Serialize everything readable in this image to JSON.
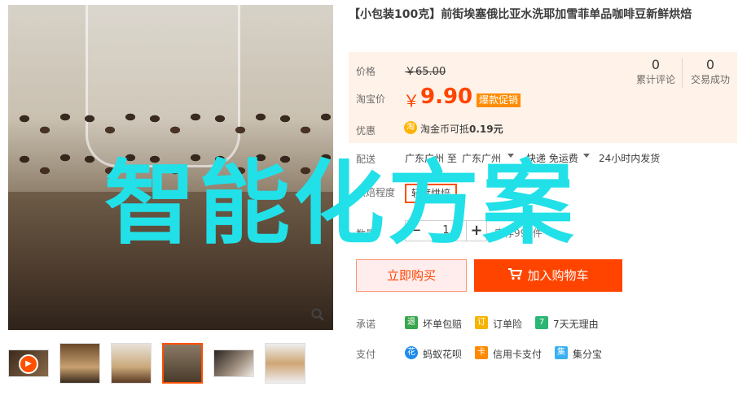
{
  "product": {
    "title": "【小包装100克】前街埃塞俄比亚水洗耶加雪菲单品咖啡豆新鲜烘焙"
  },
  "price": {
    "label": "价格",
    "original": "￥65.00",
    "sale_label": "淘宝价",
    "sale_currency": "￥",
    "sale_value": "9.90",
    "promo_badge": "爆款促销"
  },
  "stats": {
    "reviews_count": "0",
    "reviews_label": "累计评论",
    "sales_count": "0",
    "sales_label": "交易成功"
  },
  "coupon": {
    "label": "优惠",
    "icon": "淘",
    "text_prefix": "淘金币可抵",
    "amount": "0.19元"
  },
  "shipping": {
    "label": "配送",
    "from": "广东广州 至",
    "to": "广东广州",
    "method": "快递 免运费",
    "dispatch": "24小时内发货"
  },
  "roast": {
    "label": "烘焙程度",
    "option": "轻度烘焙"
  },
  "quantity": {
    "label": "数量",
    "minus": "−",
    "value": "1",
    "plus": "+",
    "stock": "库存999件"
  },
  "actions": {
    "buy_now": "立即购买",
    "add_cart": "加入购物车",
    "cart_icon": "cart-icon"
  },
  "promises": {
    "label": "承诺",
    "items": [
      {
        "icon": "退",
        "text": "坏单包赔",
        "color": "#3aa64c"
      },
      {
        "icon": "订",
        "text": "订单险",
        "color": "#f5b400"
      },
      {
        "icon": "7",
        "text": "7天无理由",
        "color": "#2bb673"
      }
    ]
  },
  "payment": {
    "label": "支付",
    "items": [
      {
        "icon": "花",
        "text": "蚂蚁花呗",
        "color": "#1f8ceb"
      },
      {
        "icon": "卡",
        "text": "信用卡支付",
        "color": "#ff8a00"
      },
      {
        "icon": "集",
        "text": "集分宝",
        "color": "#3bb0f0"
      }
    ]
  },
  "watermark": "智能化方案"
}
